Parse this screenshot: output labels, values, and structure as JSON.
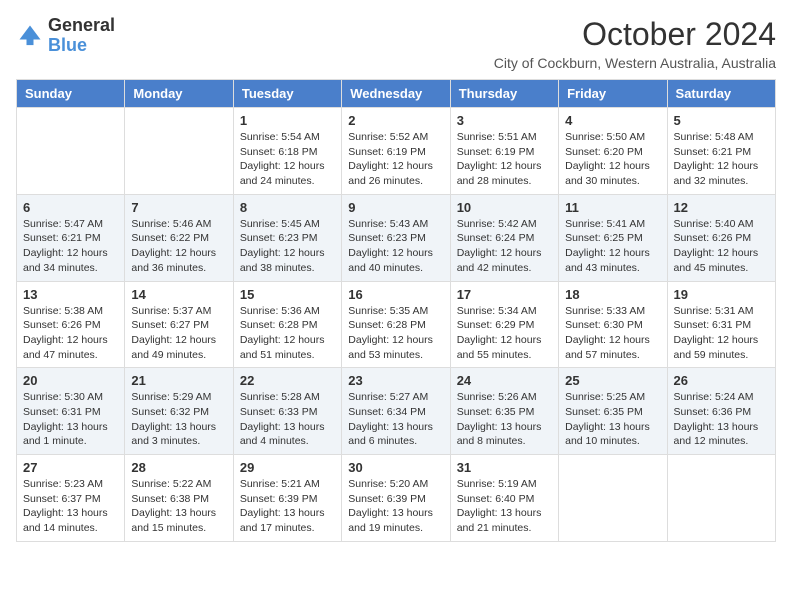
{
  "logo": {
    "general": "General",
    "blue": "Blue"
  },
  "header": {
    "title": "October 2024",
    "subtitle": "City of Cockburn, Western Australia, Australia"
  },
  "days_of_week": [
    "Sunday",
    "Monday",
    "Tuesday",
    "Wednesday",
    "Thursday",
    "Friday",
    "Saturday"
  ],
  "weeks": [
    [
      {
        "day": "",
        "info": ""
      },
      {
        "day": "",
        "info": ""
      },
      {
        "day": "1",
        "info": "Sunrise: 5:54 AM\nSunset: 6:18 PM\nDaylight: 12 hours and 24 minutes."
      },
      {
        "day": "2",
        "info": "Sunrise: 5:52 AM\nSunset: 6:19 PM\nDaylight: 12 hours and 26 minutes."
      },
      {
        "day": "3",
        "info": "Sunrise: 5:51 AM\nSunset: 6:19 PM\nDaylight: 12 hours and 28 minutes."
      },
      {
        "day": "4",
        "info": "Sunrise: 5:50 AM\nSunset: 6:20 PM\nDaylight: 12 hours and 30 minutes."
      },
      {
        "day": "5",
        "info": "Sunrise: 5:48 AM\nSunset: 6:21 PM\nDaylight: 12 hours and 32 minutes."
      }
    ],
    [
      {
        "day": "6",
        "info": "Sunrise: 5:47 AM\nSunset: 6:21 PM\nDaylight: 12 hours and 34 minutes."
      },
      {
        "day": "7",
        "info": "Sunrise: 5:46 AM\nSunset: 6:22 PM\nDaylight: 12 hours and 36 minutes."
      },
      {
        "day": "8",
        "info": "Sunrise: 5:45 AM\nSunset: 6:23 PM\nDaylight: 12 hours and 38 minutes."
      },
      {
        "day": "9",
        "info": "Sunrise: 5:43 AM\nSunset: 6:23 PM\nDaylight: 12 hours and 40 minutes."
      },
      {
        "day": "10",
        "info": "Sunrise: 5:42 AM\nSunset: 6:24 PM\nDaylight: 12 hours and 42 minutes."
      },
      {
        "day": "11",
        "info": "Sunrise: 5:41 AM\nSunset: 6:25 PM\nDaylight: 12 hours and 43 minutes."
      },
      {
        "day": "12",
        "info": "Sunrise: 5:40 AM\nSunset: 6:26 PM\nDaylight: 12 hours and 45 minutes."
      }
    ],
    [
      {
        "day": "13",
        "info": "Sunrise: 5:38 AM\nSunset: 6:26 PM\nDaylight: 12 hours and 47 minutes."
      },
      {
        "day": "14",
        "info": "Sunrise: 5:37 AM\nSunset: 6:27 PM\nDaylight: 12 hours and 49 minutes."
      },
      {
        "day": "15",
        "info": "Sunrise: 5:36 AM\nSunset: 6:28 PM\nDaylight: 12 hours and 51 minutes."
      },
      {
        "day": "16",
        "info": "Sunrise: 5:35 AM\nSunset: 6:28 PM\nDaylight: 12 hours and 53 minutes."
      },
      {
        "day": "17",
        "info": "Sunrise: 5:34 AM\nSunset: 6:29 PM\nDaylight: 12 hours and 55 minutes."
      },
      {
        "day": "18",
        "info": "Sunrise: 5:33 AM\nSunset: 6:30 PM\nDaylight: 12 hours and 57 minutes."
      },
      {
        "day": "19",
        "info": "Sunrise: 5:31 AM\nSunset: 6:31 PM\nDaylight: 12 hours and 59 minutes."
      }
    ],
    [
      {
        "day": "20",
        "info": "Sunrise: 5:30 AM\nSunset: 6:31 PM\nDaylight: 13 hours and 1 minute."
      },
      {
        "day": "21",
        "info": "Sunrise: 5:29 AM\nSunset: 6:32 PM\nDaylight: 13 hours and 3 minutes."
      },
      {
        "day": "22",
        "info": "Sunrise: 5:28 AM\nSunset: 6:33 PM\nDaylight: 13 hours and 4 minutes."
      },
      {
        "day": "23",
        "info": "Sunrise: 5:27 AM\nSunset: 6:34 PM\nDaylight: 13 hours and 6 minutes."
      },
      {
        "day": "24",
        "info": "Sunrise: 5:26 AM\nSunset: 6:35 PM\nDaylight: 13 hours and 8 minutes."
      },
      {
        "day": "25",
        "info": "Sunrise: 5:25 AM\nSunset: 6:35 PM\nDaylight: 13 hours and 10 minutes."
      },
      {
        "day": "26",
        "info": "Sunrise: 5:24 AM\nSunset: 6:36 PM\nDaylight: 13 hours and 12 minutes."
      }
    ],
    [
      {
        "day": "27",
        "info": "Sunrise: 5:23 AM\nSunset: 6:37 PM\nDaylight: 13 hours and 14 minutes."
      },
      {
        "day": "28",
        "info": "Sunrise: 5:22 AM\nSunset: 6:38 PM\nDaylight: 13 hours and 15 minutes."
      },
      {
        "day": "29",
        "info": "Sunrise: 5:21 AM\nSunset: 6:39 PM\nDaylight: 13 hours and 17 minutes."
      },
      {
        "day": "30",
        "info": "Sunrise: 5:20 AM\nSunset: 6:39 PM\nDaylight: 13 hours and 19 minutes."
      },
      {
        "day": "31",
        "info": "Sunrise: 5:19 AM\nSunset: 6:40 PM\nDaylight: 13 hours and 21 minutes."
      },
      {
        "day": "",
        "info": ""
      },
      {
        "day": "",
        "info": ""
      }
    ]
  ]
}
